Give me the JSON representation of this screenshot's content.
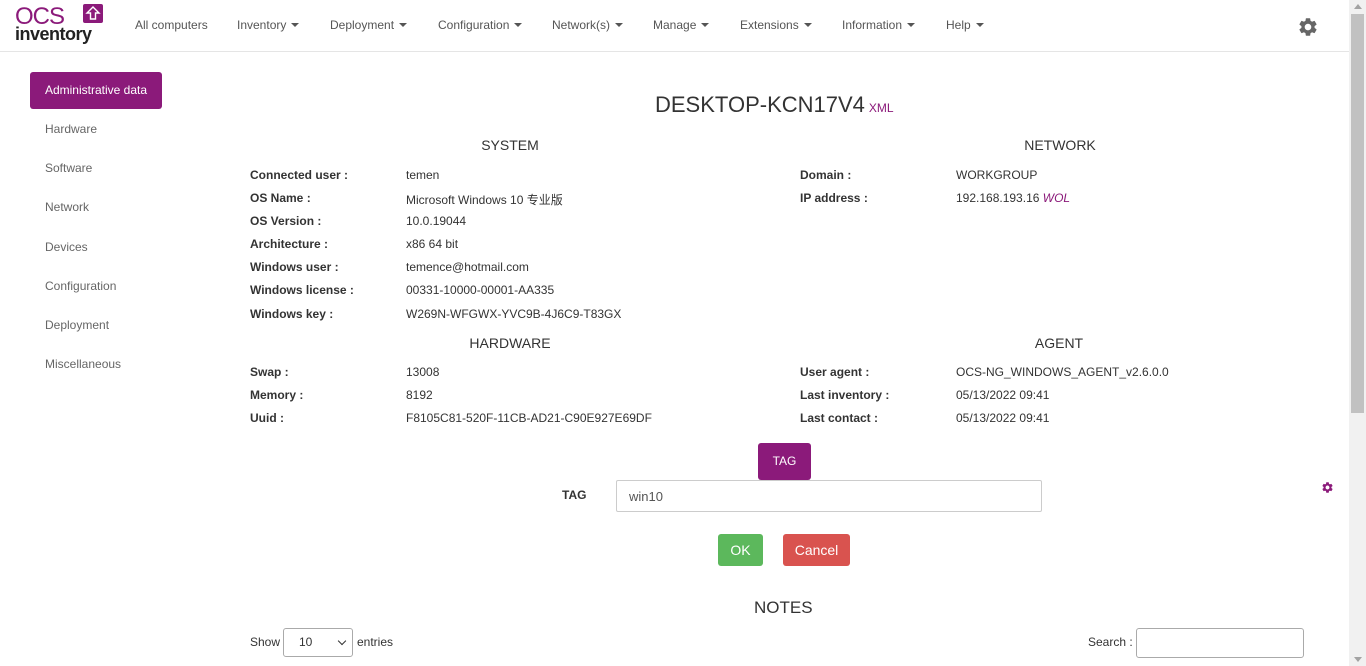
{
  "brand": {
    "top": "OCS",
    "bottom": "inventory",
    "color": "#8b1a7a"
  },
  "nav": {
    "all_computers": "All computers",
    "inventory": "Inventory",
    "deployment": "Deployment",
    "configuration": "Configuration",
    "networks": "Network(s)",
    "manage": "Manage",
    "extensions": "Extensions",
    "information": "Information",
    "help": "Help"
  },
  "sidebar": {
    "active": "Administrative data",
    "items": [
      "Hardware",
      "Software",
      "Network",
      "Devices",
      "Configuration",
      "Deployment",
      "Miscellaneous"
    ]
  },
  "computer": {
    "name": "DESKTOP-KCN17V4",
    "xml_link": "XML"
  },
  "system": {
    "heading": "SYSTEM",
    "rows": [
      {
        "label": "Connected user :",
        "value": "temen"
      },
      {
        "label": "OS Name :",
        "value": "Microsoft Windows 10 专业版"
      },
      {
        "label": "OS Version :",
        "value": "10.0.19044"
      },
      {
        "label": "Architecture :",
        "value": "x86 64 bit"
      },
      {
        "label": "Windows user :",
        "value": "temence@hotmail.com"
      },
      {
        "label": "Windows license :",
        "value": "00331-10000-00001-AA335"
      },
      {
        "label": "Windows key :",
        "value": "W269N-WFGWX-YVC9B-4J6C9-T83GX"
      }
    ]
  },
  "network": {
    "heading": "NETWORK",
    "rows": [
      {
        "label": "Domain :",
        "value": "WORKGROUP"
      },
      {
        "label": "IP address :",
        "value": "192.168.193.16",
        "extra": "WOL"
      }
    ]
  },
  "hardware": {
    "heading": "HARDWARE",
    "rows": [
      {
        "label": "Swap :",
        "value": "13008"
      },
      {
        "label": "Memory :",
        "value": "8192"
      },
      {
        "label": "Uuid :",
        "value": "F8105C81-520F-11CB-AD21-C90E927E69DF"
      }
    ]
  },
  "agent": {
    "heading": "AGENT",
    "rows": [
      {
        "label": "User agent :",
        "value": "OCS-NG_WINDOWS_AGENT_v2.6.0.0"
      },
      {
        "label": "Last inventory :",
        "value": "05/13/2022 09:41"
      },
      {
        "label": "Last contact :",
        "value": "05/13/2022 09:41"
      }
    ]
  },
  "tag": {
    "button": "TAG",
    "label": "TAG",
    "value": "win10"
  },
  "actions": {
    "ok": "OK",
    "cancel": "Cancel"
  },
  "notes": {
    "heading": "NOTES",
    "show_label": "Show",
    "page_size": "10",
    "entries_label": "entries",
    "search_label": "Search :"
  },
  "colors": {
    "accent": "#8b1a7a",
    "ok": "#5cb85c",
    "cancel": "#d9534f"
  },
  "icons": {
    "settings": "gear-icon",
    "small_settings": "gear-icon"
  }
}
